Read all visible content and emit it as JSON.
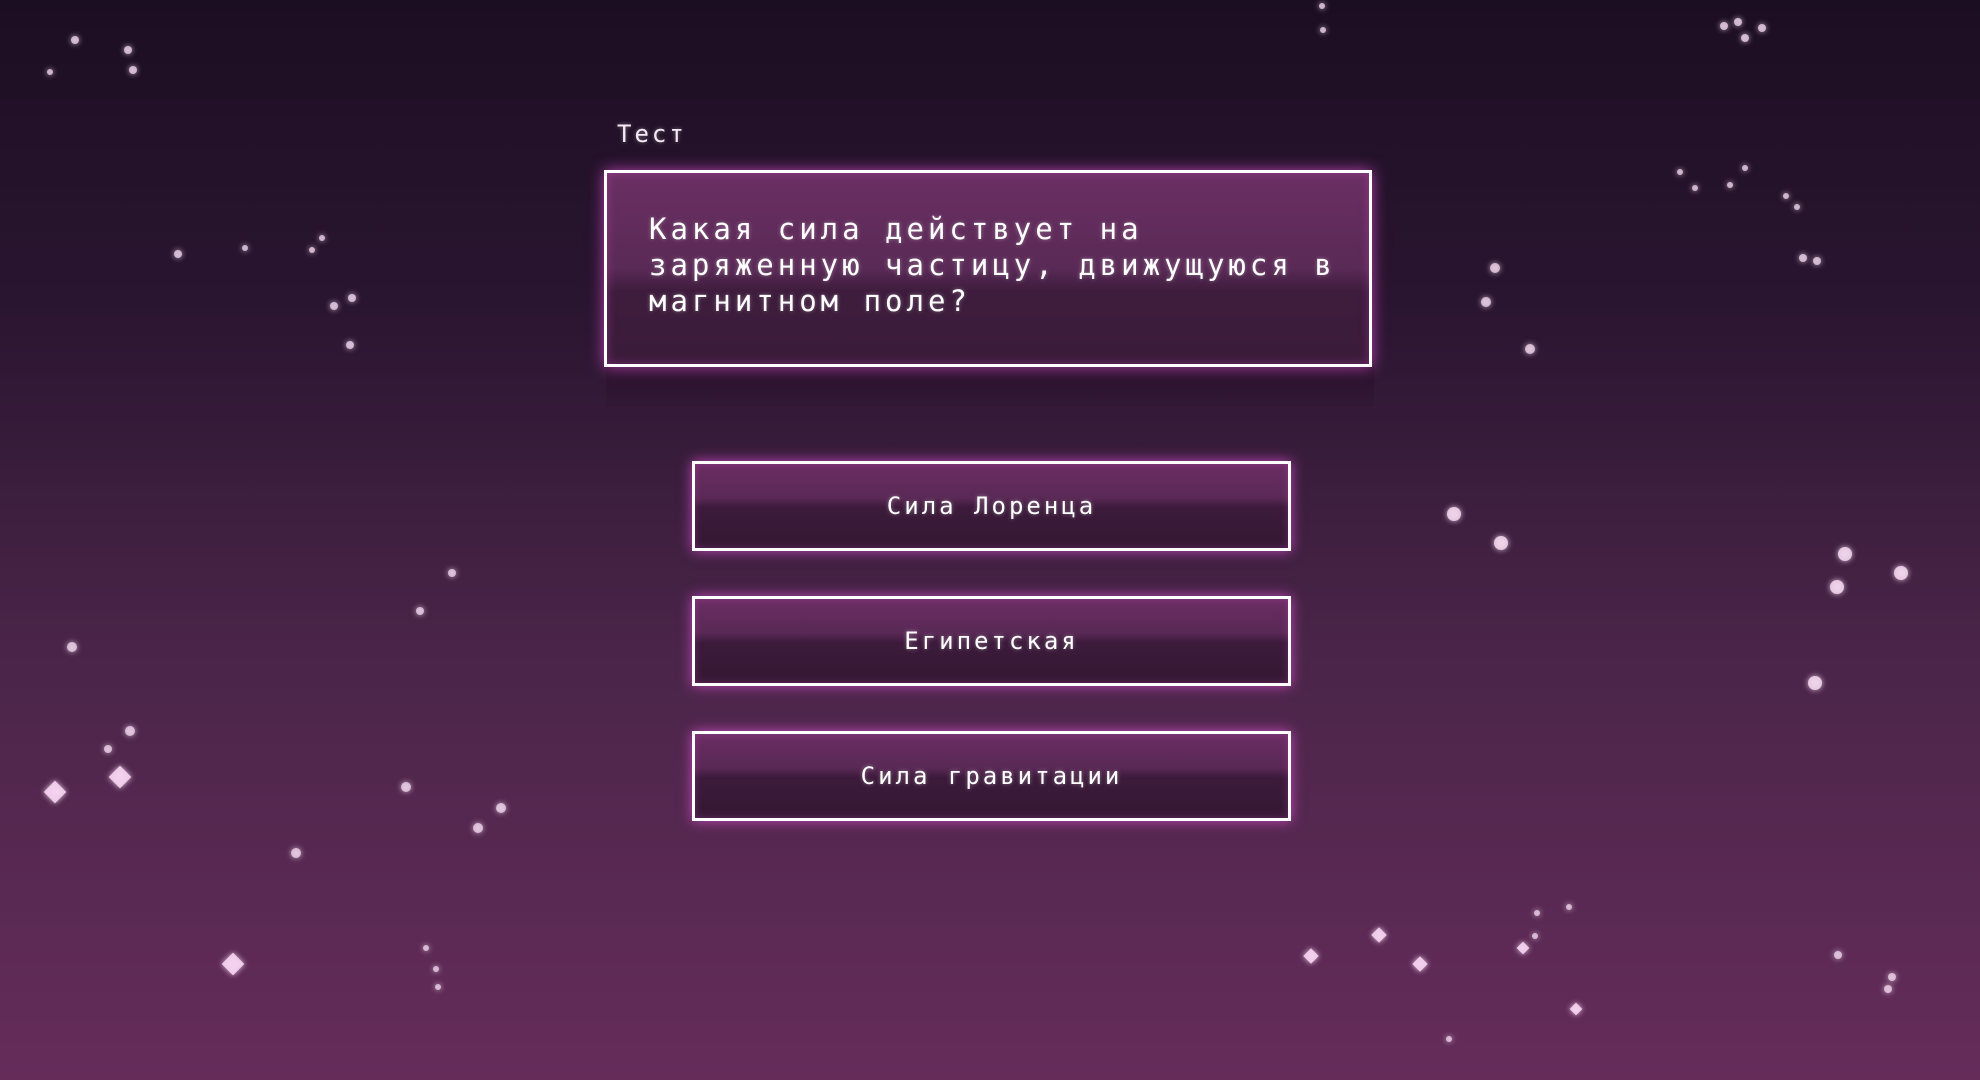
{
  "quiz": {
    "label": "Тест",
    "question": "Какая сила действует на заряженную частицу, движущуюся в магнитном поле?",
    "answers": [
      {
        "label": "Сила Лоренца"
      },
      {
        "label": "Египетская"
      },
      {
        "label": "Сила гравитации"
      }
    ]
  },
  "colors": {
    "background_top": "#1c0e22",
    "background_bottom": "#652c5a",
    "panel_fill": "#5a2a56",
    "border": "#ffffff",
    "glow": "#dc50d2"
  }
}
